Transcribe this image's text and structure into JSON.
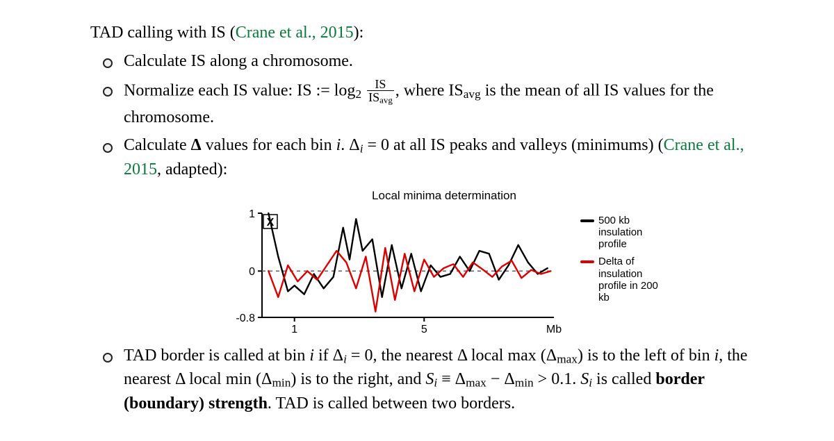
{
  "intro_prefix": "TAD calling with IS (",
  "intro_ref": "Crane et al., 2015",
  "intro_suffix": "):",
  "b1": "Calculate IS along a chromosome.",
  "b2_a": "Normalize each IS value: IS := log",
  "b2_sub2": "2",
  "b2_frac_num": "IS",
  "b2_frac_den_a": "IS",
  "b2_frac_den_sub": "avg",
  "b2_b": ", where IS",
  "b2_b_sub": "avg",
  "b2_c": " is the mean of all IS values for the chromosome.",
  "b3_a": "Calculate ",
  "b3_delta_bold": "Δ",
  "b3_b": " values for each bin ",
  "b3_i": "i",
  "b3_c": ". Δ",
  "b3_c_sub": "i",
  "b3_d": " = 0 at all IS peaks and valleys (minimums) (",
  "b3_ref": "Crane et al., 2015",
  "b3_e": ", adapted):",
  "b4_a": "TAD border is called at bin ",
  "b4_i1": "i",
  "b4_b": " if Δ",
  "b4_b_sub": "i",
  "b4_c": " = 0, the nearest Δ local max (Δ",
  "b4_c_sub": "max",
  "b4_d": ") is to the left of bin ",
  "b4_i2": "i",
  "b4_e": ", the nearest Δ local min (Δ",
  "b4_e_sub": "min",
  "b4_f": ") is to the right, and ",
  "b4_si": "S",
  "b4_si_sub": "i",
  "b4_g": " ≡ Δ",
  "b4_g_sub": "max",
  "b4_h": " − Δ",
  "b4_h_sub": "min",
  "b4_i3": " > 0.1. ",
  "b4_si2": "S",
  "b4_si2_sub": "i",
  "b4_j": " is called ",
  "b4_bold": "border (boundary) strength",
  "b4_k": ". TAD is called between two borders.",
  "chart": {
    "title": "Local minima determination",
    "y_ticks": {
      "t1": "1",
      "t0": "0",
      "tn": "-0.8"
    },
    "x_ticks": {
      "x1": "1",
      "x5": "5",
      "xmb": "Mb"
    },
    "x_marker": "X",
    "legend": {
      "l1": "500 kb insulation profile",
      "l2": "Delta of insulation profile in 200 kb"
    }
  },
  "chart_data": {
    "type": "line",
    "title": "Local minima determination",
    "xlabel": "Mb",
    "ylabel": "",
    "ylim": [
      -0.8,
      1.0
    ],
    "xlim": [
      0.0,
      9.0
    ],
    "x_ticks": [
      1,
      5
    ],
    "series": [
      {
        "name": "500 kb insulation profile",
        "color": "#000000",
        "x": [
          0.2,
          0.5,
          0.8,
          1.0,
          1.3,
          1.6,
          1.9,
          2.2,
          2.5,
          2.7,
          2.9,
          3.1,
          3.4,
          3.7,
          4.0,
          4.3,
          4.6,
          4.9,
          5.2,
          5.5,
          5.8,
          6.1,
          6.4,
          6.7,
          7.0,
          7.3,
          7.6,
          7.9,
          8.2,
          8.5,
          8.8
        ],
        "y": [
          1.0,
          0.25,
          -0.35,
          -0.25,
          -0.4,
          -0.05,
          -0.3,
          -0.1,
          0.75,
          0.2,
          0.9,
          0.35,
          0.55,
          -0.45,
          0.45,
          -0.3,
          0.3,
          -0.35,
          0.1,
          -0.1,
          -0.05,
          0.25,
          0.0,
          0.35,
          0.3,
          -0.15,
          0.1,
          0.45,
          0.15,
          -0.05,
          0.05
        ]
      },
      {
        "name": "Delta of insulation profile in 200 kb",
        "color": "#dd0000",
        "x": [
          0.2,
          0.5,
          0.8,
          1.1,
          1.4,
          1.7,
          2.0,
          2.3,
          2.6,
          2.9,
          3.2,
          3.5,
          3.8,
          4.1,
          4.4,
          4.7,
          5.0,
          5.3,
          5.6,
          5.9,
          6.2,
          6.5,
          6.8,
          7.1,
          7.4,
          7.7,
          8.0,
          8.3,
          8.6,
          8.9
        ],
        "y": [
          0.0,
          -0.45,
          0.1,
          -0.18,
          0.0,
          -0.15,
          0.1,
          0.35,
          0.15,
          -0.3,
          0.25,
          -0.7,
          0.4,
          -0.5,
          0.3,
          -0.35,
          0.2,
          -0.1,
          0.05,
          0.12,
          -0.1,
          0.15,
          0.03,
          -0.1,
          0.08,
          0.18,
          -0.12,
          0.02,
          -0.05,
          0.0
        ]
      }
    ]
  }
}
